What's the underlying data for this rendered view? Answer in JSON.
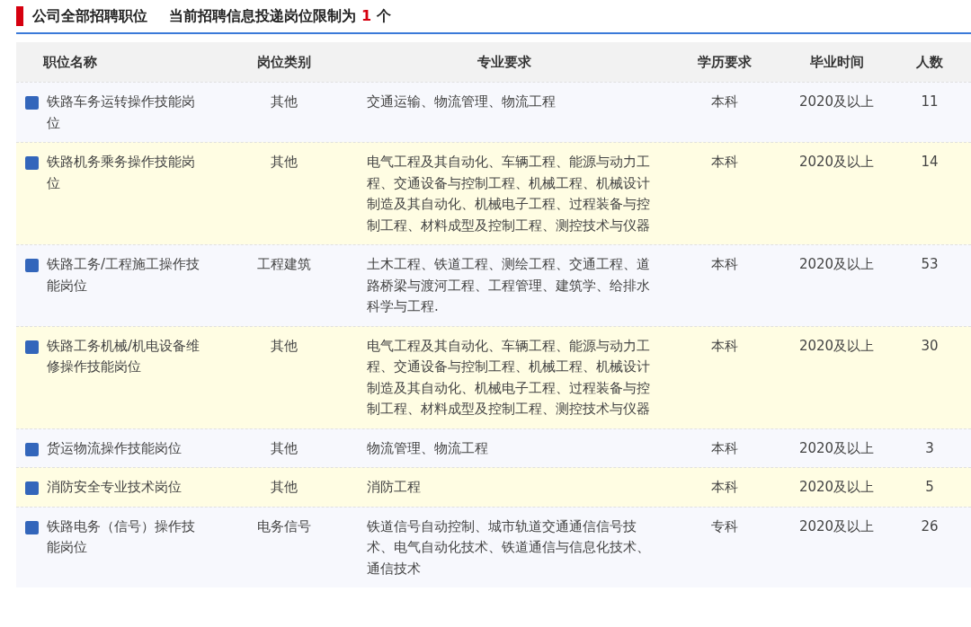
{
  "header": {
    "title": "公司全部招聘职位",
    "notice": {
      "before": "当前招聘信息投递岗位限制为",
      "count": "1",
      "after": "个"
    }
  },
  "table": {
    "columns": [
      "职位名称",
      "岗位类别",
      "专业要求",
      "学历要求",
      "毕业时间",
      "人数"
    ],
    "rows": [
      {
        "name": "铁路车务运转操作技能岗位",
        "category": "其他",
        "major": "交通运输、物流管理、物流工程",
        "education": "本科",
        "graduation": "2020及以上",
        "count": "11"
      },
      {
        "name": "铁路机务乘务操作技能岗位",
        "category": "其他",
        "major": "电气工程及其自动化、车辆工程、能源与动力工程、交通设备与控制工程、机械工程、机械设计制造及其自动化、机械电子工程、过程装备与控制工程、材料成型及控制工程、测控技术与仪器",
        "education": "本科",
        "graduation": "2020及以上",
        "count": "14"
      },
      {
        "name": "铁路工务/工程施工操作技能岗位",
        "category": "工程建筑",
        "major": "土木工程、铁道工程、测绘工程、交通工程、道路桥梁与渡河工程、工程管理、建筑学、给排水科学与工程.",
        "education": "本科",
        "graduation": "2020及以上",
        "count": "53"
      },
      {
        "name": "铁路工务机械/机电设备维修操作技能岗位",
        "category": "其他",
        "major": "电气工程及其自动化、车辆工程、能源与动力工程、交通设备与控制工程、机械工程、机械设计制造及其自动化、机械电子工程、过程装备与控制工程、材料成型及控制工程、测控技术与仪器",
        "education": "本科",
        "graduation": "2020及以上",
        "count": "30"
      },
      {
        "name": "货运物流操作技能岗位",
        "category": "其他",
        "major": "物流管理、物流工程",
        "education": "本科",
        "graduation": "2020及以上",
        "count": "3"
      },
      {
        "name": "消防安全专业技术岗位",
        "category": "其他",
        "major": "消防工程",
        "education": "本科",
        "graduation": "2020及以上",
        "count": "5"
      },
      {
        "name": "铁路电务（信号）操作技能岗位",
        "category": "电务信号",
        "major": "铁道信号自动控制、城市轨道交通通信信号技术、电气自动化技术、铁道通信与信息化技术、通信技术",
        "education": "专科",
        "graduation": "2020及以上",
        "count": "26"
      }
    ]
  }
}
